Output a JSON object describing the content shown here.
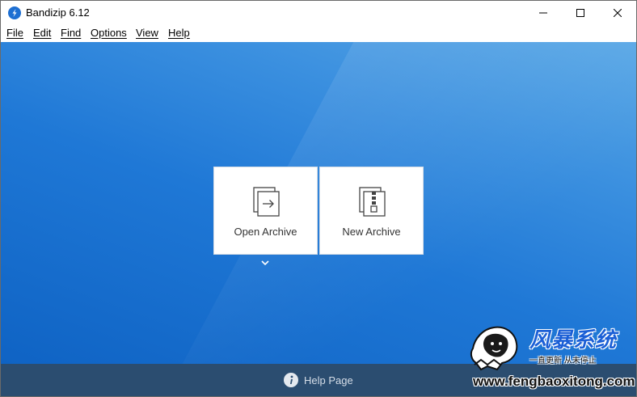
{
  "window": {
    "title": "Bandizip 6.12",
    "controls": {
      "minimize_icon": "minimize-icon",
      "maximize_icon": "maximize-icon",
      "close_icon": "close-icon"
    }
  },
  "menubar": {
    "items": [
      {
        "label": "File"
      },
      {
        "label": "Edit"
      },
      {
        "label": "Find"
      },
      {
        "label": "Options"
      },
      {
        "label": "View"
      },
      {
        "label": "Help"
      }
    ]
  },
  "actions": {
    "open_archive": {
      "label": "Open Archive",
      "icon": "open-archive-icon"
    },
    "new_archive": {
      "label": "New Archive",
      "icon": "new-archive-icon"
    },
    "more_icon": "chevron-down-icon"
  },
  "footer": {
    "help_label": "Help Page",
    "help_icon": "info-icon"
  },
  "watermark": {
    "title": "风暴系统",
    "subtitle": "一直更新  从未停止",
    "url": "www.fengbaoxitong.com"
  },
  "colors": {
    "background_top": "#5aa8e6",
    "background_bottom": "#0f63c4",
    "footer": "#2b4d70",
    "card": "#ffffff",
    "accent": "#1e6fd2"
  }
}
